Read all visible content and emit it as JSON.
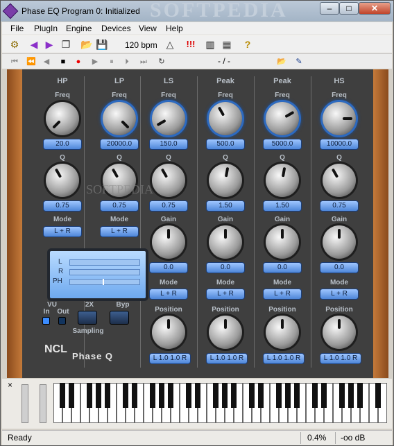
{
  "window": {
    "title": "Phase EQ Program 0: Initialized",
    "watermark": "SOFTPEDIA",
    "min": "–",
    "max": "□",
    "close": "✕"
  },
  "menu": [
    "File",
    "PlugIn",
    "Engine",
    "Devices",
    "View",
    "Help"
  ],
  "toolbar": {
    "tempo": "120 bpm",
    "position": "- / -",
    "alert": "!!!",
    "help": "?"
  },
  "bands": [
    {
      "header": "HP",
      "freq": "20.0",
      "q": "0.75",
      "mode": "L + R"
    },
    {
      "header": "LP",
      "freq": "20000.0",
      "q": "0.75",
      "mode": "L + R"
    },
    {
      "header": "LS",
      "freq": "150.0",
      "q": "0.75",
      "gain": "0.0",
      "mode": "L + R",
      "position": "L 1.0   1.0 R"
    },
    {
      "header": "Peak",
      "freq": "500.0",
      "q": "1.50",
      "gain": "0.0",
      "mode": "L + R",
      "position": "L 1.0   1.0 R"
    },
    {
      "header": "Peak",
      "freq": "5000.0",
      "q": "1.50",
      "gain": "0.0",
      "mode": "L + R",
      "position": "L 1.0   1.0 R"
    },
    {
      "header": "HS",
      "freq": "10000.0",
      "q": "0.75",
      "gain": "0.0",
      "mode": "L + R",
      "position": "L 1.0   1.0 R"
    }
  ],
  "labels": {
    "freq": "Freq",
    "q": "Q",
    "gain": "Gain",
    "mode": "Mode",
    "position": "Position"
  },
  "meter": {
    "l": "L",
    "r": "R",
    "ph": "PH"
  },
  "controls": {
    "vu": "VU",
    "in": "In",
    "out": "Out",
    "x2": "2X",
    "byp": "Byp",
    "sampling": "Sampling"
  },
  "logo": {
    "a": "NCL",
    "b": "Phase Q"
  },
  "watermark2": "SOFTPEDIA",
  "status": {
    "text": "Ready",
    "pct": "0.4%",
    "db": "-oo dB"
  },
  "keyboard": {
    "close": "×"
  }
}
